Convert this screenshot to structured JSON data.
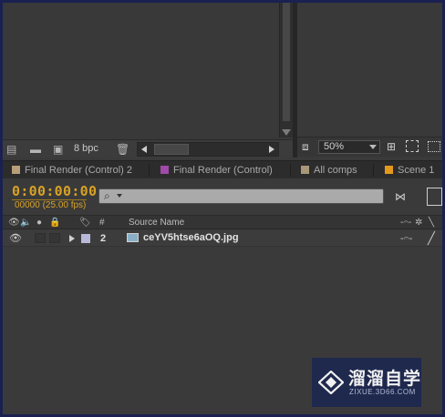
{
  "project_panel": {
    "bit_depth": "8 bpc",
    "icons": [
      "interpret-footage-icon",
      "new-folder-icon",
      "new-composition-icon",
      "trash-icon"
    ]
  },
  "comp_viewer": {
    "zoom": "50%"
  },
  "timeline_tabs": [
    {
      "label": "Final Render (Control) 2",
      "color": "#b89e7a"
    },
    {
      "label": "Final Render (Control)",
      "color": "#a04aa8"
    },
    {
      "label": "All comps",
      "color": "#a89878"
    },
    {
      "label": "Scene 1",
      "color": "#e39a1c"
    }
  ],
  "timeline": {
    "timecode": "0:00:00:00",
    "frames_fps": "00000 (25.00 fps)",
    "columns": {
      "number": "#",
      "source_name": "Source Name"
    },
    "layers": [
      {
        "number": "2",
        "name": "ceYV5htse6aOQ.jpg",
        "label_color": "#b8b8d8"
      }
    ]
  },
  "watermark": {
    "name": "溜溜自学",
    "url": "ZIXUE.3D66.COM"
  }
}
